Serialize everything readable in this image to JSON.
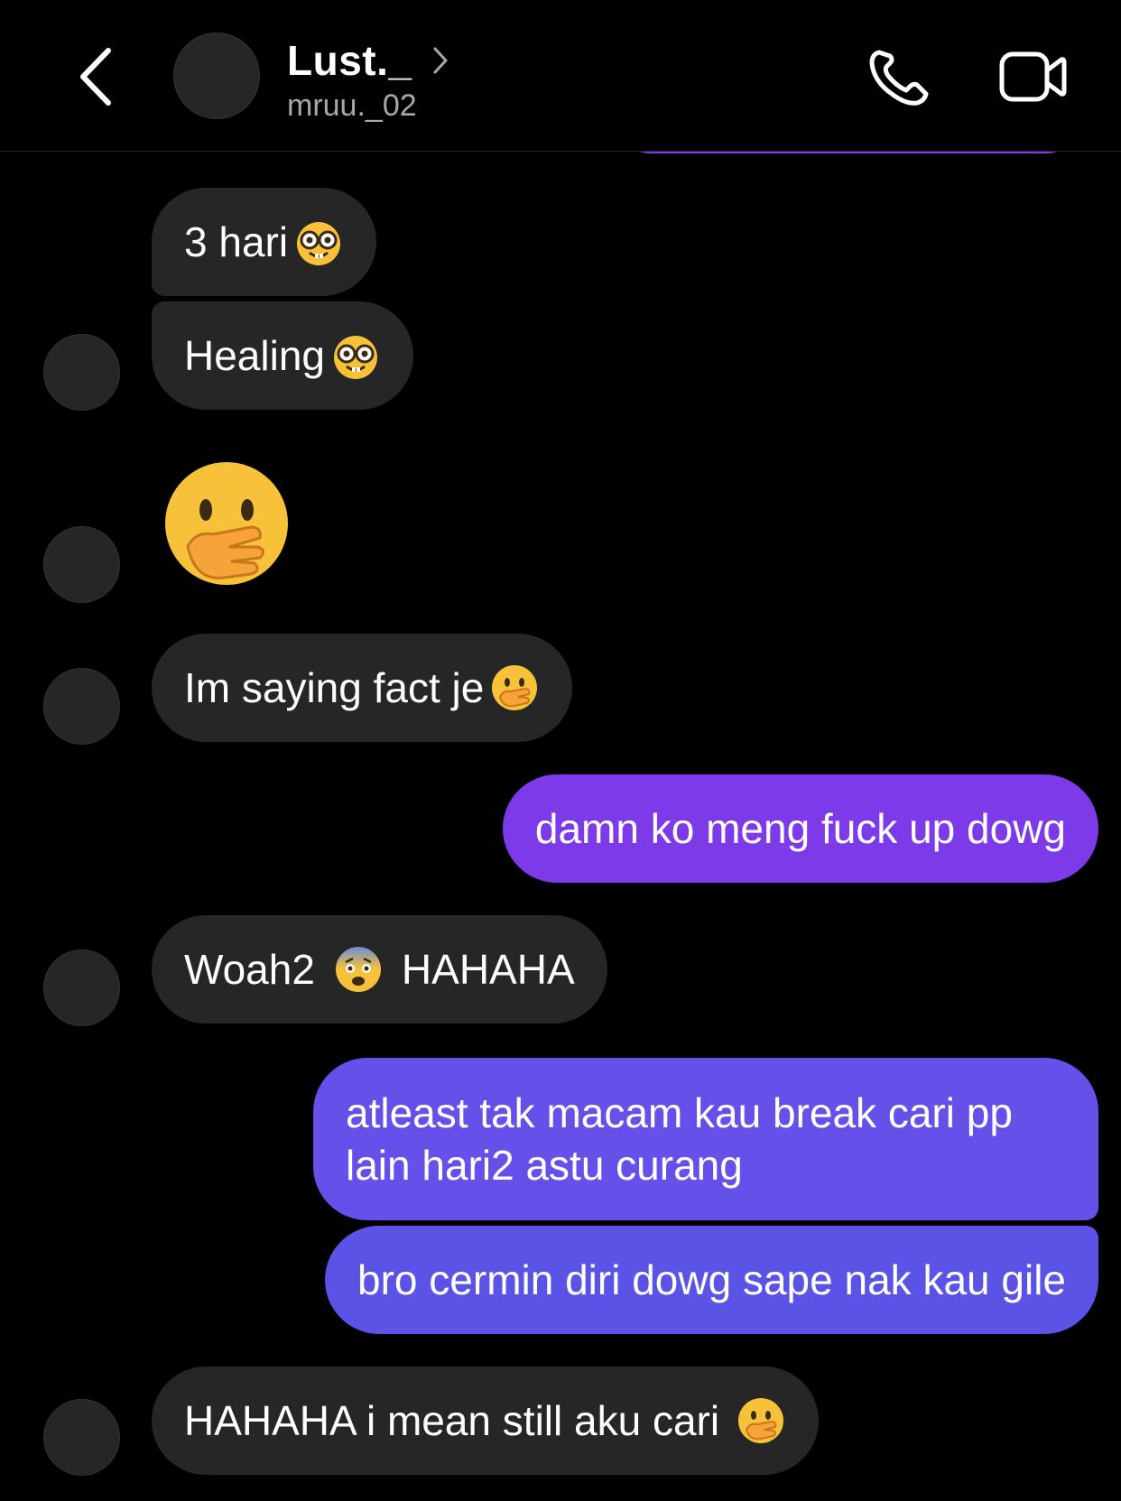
{
  "header": {
    "contact_name": "Lust._",
    "username": "mruu._02"
  },
  "messages": {
    "m1": {
      "text": "3 hari",
      "emoji": "nerd-face"
    },
    "m2": {
      "text": "Healing",
      "emoji": "nerd-face"
    },
    "m3": {
      "emoji": "face-with-hand-over-mouth"
    },
    "m4": {
      "text": "Im saying fact je",
      "emoji": "face-with-hand-over-mouth"
    },
    "m5": {
      "text": "damn ko meng fuck up dowg"
    },
    "m6": {
      "text_before": "Woah2",
      "emoji": "fearful-face",
      "text_after": "HAHAHA"
    },
    "m7": {
      "line1": "atleast tak macam kau break cari pp",
      "line2": "lain hari2 astu curang"
    },
    "m8": {
      "text": "bro cermin diri dowg sape nak kau gile"
    },
    "m9": {
      "text": "HAHAHA i mean still aku cari",
      "emoji": "face-with-hand-over-mouth"
    }
  },
  "colors": {
    "background": "#000000",
    "incoming_bubble": "#262626",
    "outgoing_purple": "#7c3ae8",
    "outgoing_indigo": "#5b52e6"
  }
}
